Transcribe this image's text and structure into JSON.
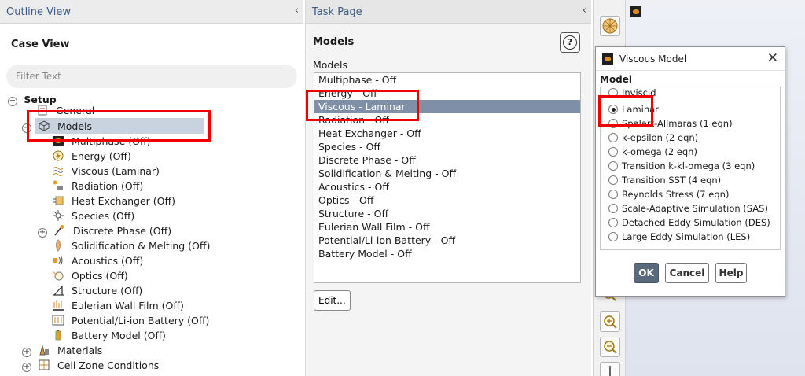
{
  "outline": {
    "header": "Outline View",
    "collapse": "‹",
    "case_view": "Case View",
    "filter_placeholder": "Filter Text",
    "setup": "Setup",
    "general": "General",
    "models": "Models",
    "model_items": [
      "Multiphase (Off)",
      "Energy (Off)",
      "Viscous (Laminar)",
      "Radiation (Off)",
      "Heat Exchanger (Off)",
      "Species (Off)",
      "Discrete Phase (Off)",
      "Solidification & Melting (Off)",
      "Acoustics (Off)",
      "Optics (Off)",
      "Structure (Off)",
      "Eulerian Wall Film (Off)",
      "Potential/Li-ion Battery (Off)",
      "Battery Model (Off)"
    ],
    "materials": "Materials",
    "cell_zone": "Cell Zone Conditions",
    "toggle_minus": "−",
    "toggle_plus": "+"
  },
  "task_page": {
    "header": "Task Page",
    "collapse": "‹",
    "title": "Models",
    "help": "?",
    "list_label": "Models",
    "list_items": [
      "Multiphase - Off",
      "Energy - Off",
      "Viscous - Laminar",
      "Radiation - Off",
      "Heat Exchanger - Off",
      "Species - Off",
      "Discrete Phase - Off",
      "Solidification & Melting - Off",
      "Acoustics - Off",
      "Optics - Off",
      "Structure - Off",
      "Eulerian Wall Film - Off",
      "Potential/Li-ion Battery - Off",
      "Battery Model - Off"
    ],
    "selected_index": 2,
    "edit_button": "Edit..."
  },
  "dialog": {
    "title": "Viscous Model",
    "close": "✕",
    "section": "Model",
    "options": [
      "Inviscid",
      "Laminar",
      "Spalart-Allmaras (1 eqn)",
      "k-epsilon (2 eqn)",
      "k-omega (2 eqn)",
      "Transition k-kl-omega (3 eqn)",
      "Transition SST (4 eqn)",
      "Reynolds Stress (7 eqn)",
      "Scale-Adaptive Simulation (SAS)",
      "Detached Eddy Simulation (DES)",
      "Large Eddy Simulation (LES)"
    ],
    "selected_option": "Laminar",
    "ok": "OK",
    "cancel": "Cancel",
    "help": "Help"
  },
  "colors": {
    "annotation": "#ee0000",
    "selection": "#7e8fa7",
    "header_text": "#3a5b86"
  }
}
